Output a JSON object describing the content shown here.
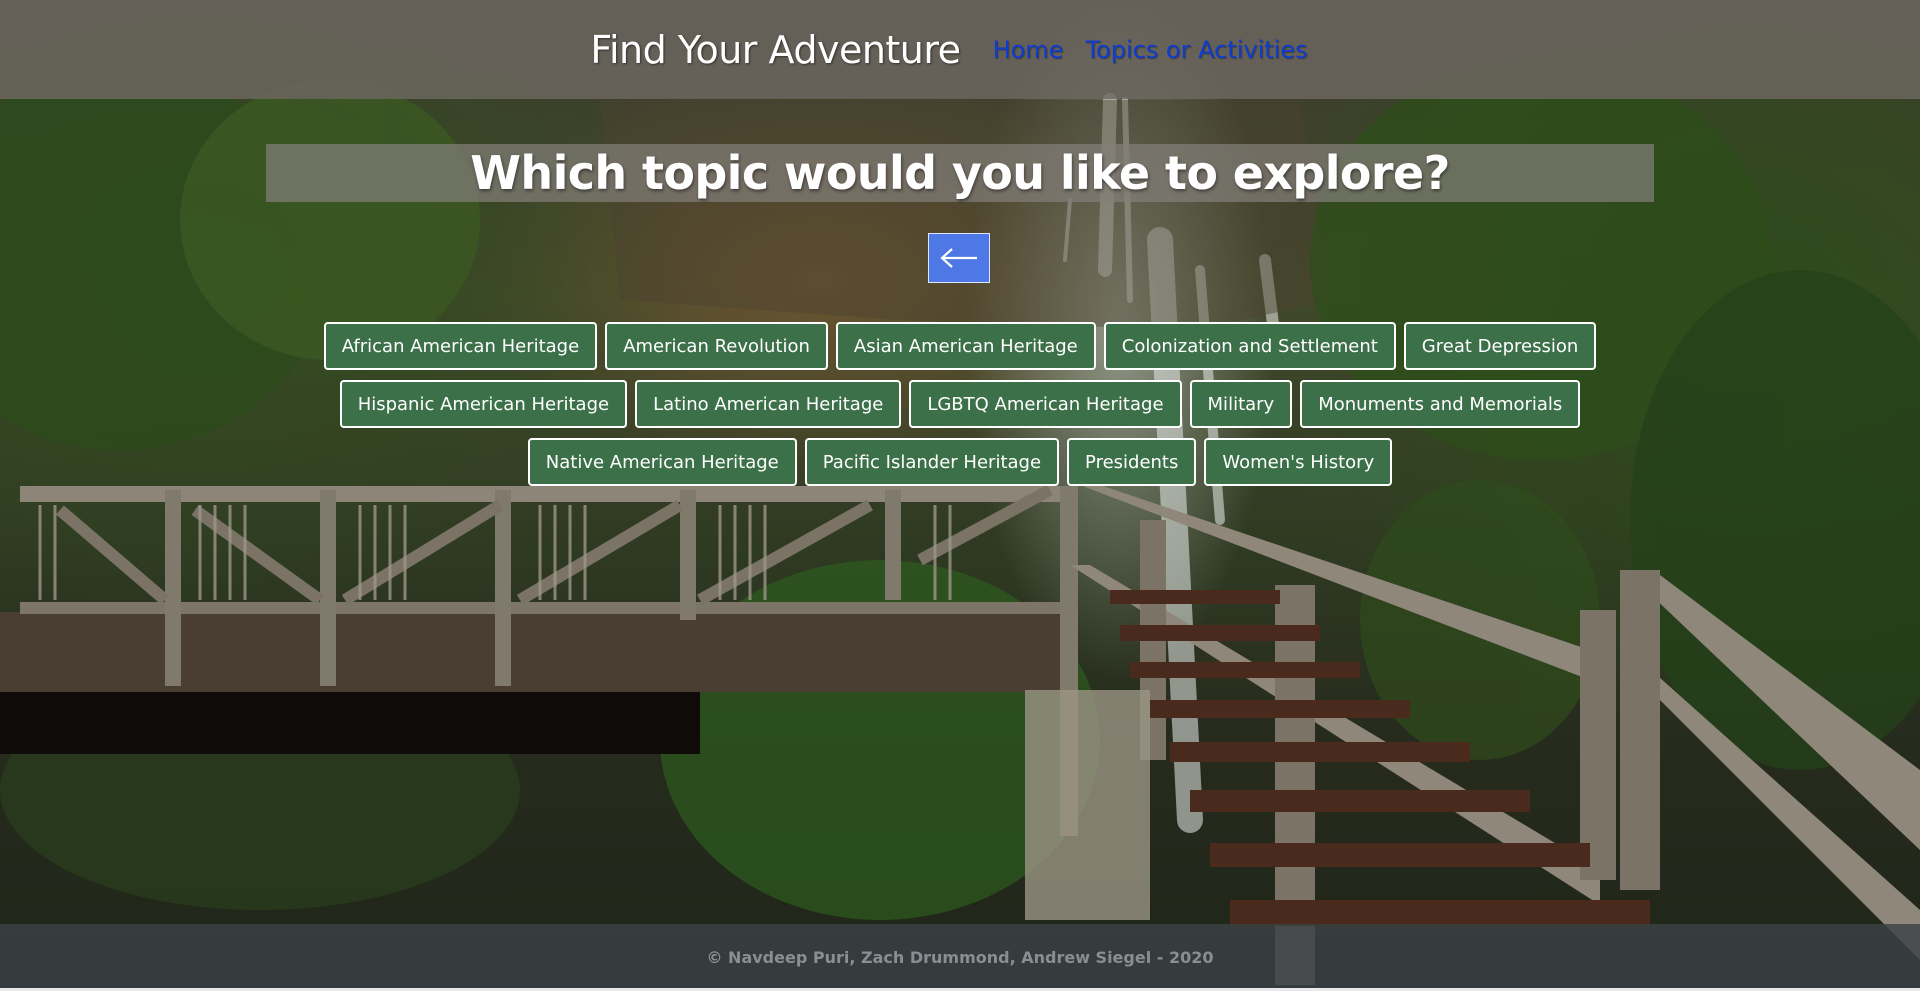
{
  "header": {
    "brand": "Find Your Adventure",
    "nav": [
      {
        "label": "Home"
      },
      {
        "label": "Topics or Activities"
      }
    ]
  },
  "main": {
    "question": "Which topic would you like to explore?",
    "back_button": {
      "icon": "arrow-left-icon"
    },
    "topic_rows": [
      [
        {
          "label": "African American Heritage"
        },
        {
          "label": "American Revolution"
        },
        {
          "label": "Asian American Heritage"
        },
        {
          "label": "Colonization and Settlement"
        },
        {
          "label": "Great Depression"
        }
      ],
      [
        {
          "label": "Hispanic American Heritage"
        },
        {
          "label": "Latino American Heritage"
        },
        {
          "label": "LGBTQ American Heritage"
        },
        {
          "label": "Military"
        },
        {
          "label": "Monuments and Memorials"
        }
      ],
      [
        {
          "label": "Native American Heritage"
        },
        {
          "label": "Pacific Islander Heritage"
        },
        {
          "label": "Presidents"
        },
        {
          "label": "Women's History"
        }
      ]
    ]
  },
  "footer": {
    "copyright": "© Navdeep Puri, Zach Drummond, Andrew Siegel - 2020"
  },
  "colors": {
    "topic_button_bg": "#3c7049",
    "back_button_bg": "#4e78e6",
    "nav_link": "#0d3ccf"
  }
}
